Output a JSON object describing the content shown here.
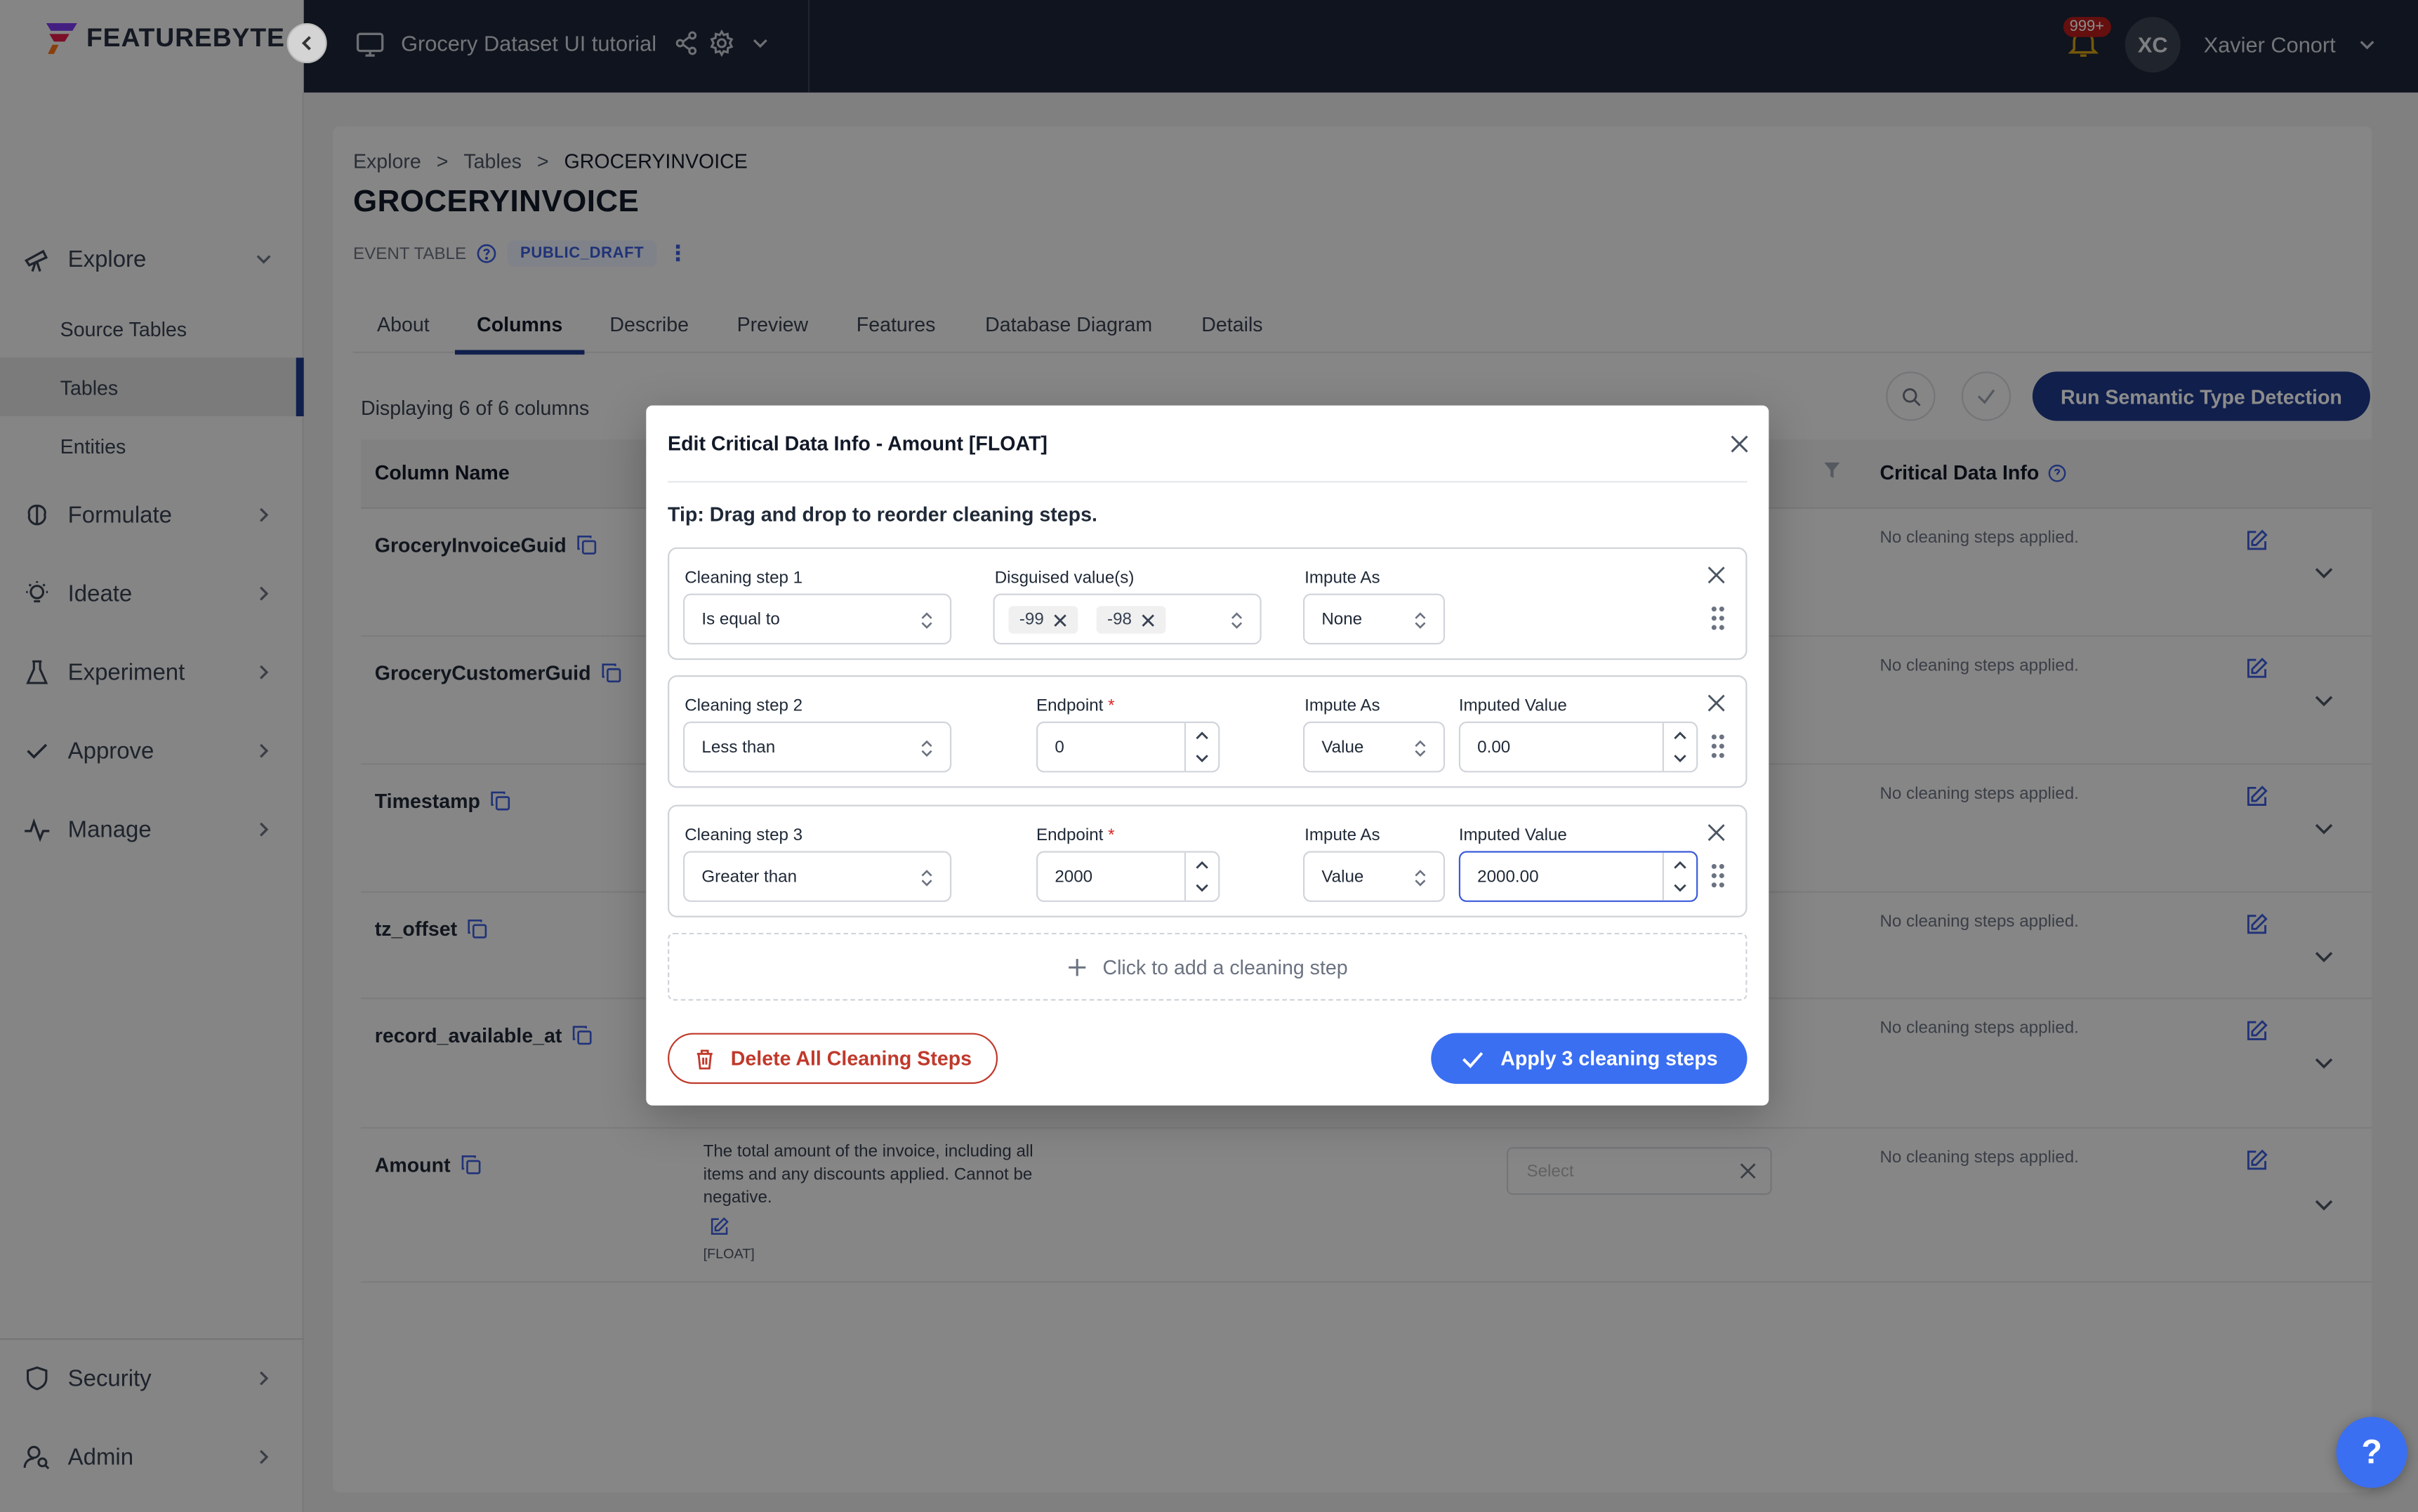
{
  "brand": {
    "name": "FEATUREBYTE"
  },
  "topbar": {
    "workspace": "Grocery Dataset UI tutorial",
    "notifications": "999+",
    "user_initials": "XC",
    "user_name": "Xavier Conort"
  },
  "sidebar": {
    "explore": "Explore",
    "explore_sub": [
      "Source Tables",
      "Tables",
      "Entities"
    ],
    "formulate": "Formulate",
    "ideate": "Ideate",
    "experiment": "Experiment",
    "approve": "Approve",
    "manage": "Manage",
    "security": "Security",
    "admin": "Admin"
  },
  "breadcrumb": [
    "Explore",
    ">",
    "Tables",
    ">",
    "GROCERYINVOICE"
  ],
  "page": {
    "title": "GROCERYINVOICE",
    "table_type": "EVENT TABLE",
    "status": "PUBLIC_DRAFT",
    "more": "⋮"
  },
  "tabs": [
    "About",
    "Columns",
    "Describe",
    "Preview",
    "Features",
    "Database Diagram",
    "Details"
  ],
  "table": {
    "display_count": "Displaying 6 of 6 columns",
    "run_button": "Run Semantic Type Detection",
    "headers": {
      "column_name": "Column Name",
      "critical": "Critical Data Info"
    },
    "rows": [
      {
        "name": "GroceryInvoiceGuid",
        "critical": "No cleaning steps applied."
      },
      {
        "name": "GroceryCustomerGuid",
        "critical": "No cleaning steps applied."
      },
      {
        "name": "Timestamp",
        "critical": "No cleaning steps applied."
      },
      {
        "name": "tz_offset",
        "critical": "No cleaning steps applied."
      },
      {
        "name": "record_available_at",
        "critical": "No cleaning steps applied."
      },
      {
        "name": "Amount",
        "critical": "No cleaning steps applied.",
        "description": "The total amount of the invoice, including all items and any discounts applied. Cannot be negative.",
        "type": "[FLOAT]",
        "select_placeholder": "Select"
      }
    ]
  },
  "modal": {
    "title": "Edit Critical Data Info - Amount [FLOAT]",
    "tip": "Tip: Drag and drop to reorder cleaning steps.",
    "steps": [
      {
        "label": "Cleaning step 1",
        "condition": "Is equal to",
        "values_label": "Disguised value(s)",
        "values": [
          "-99",
          "-98"
        ],
        "impute_label": "Impute As",
        "impute": "None"
      },
      {
        "label": "Cleaning step 2",
        "condition": "Less than",
        "endpoint_label": "Endpoint",
        "endpoint": "0",
        "impute_label": "Impute As",
        "impute": "Value",
        "imputed_label": "Imputed Value",
        "imputed": "0.00"
      },
      {
        "label": "Cleaning step 3",
        "condition": "Greater than",
        "endpoint_label": "Endpoint",
        "endpoint": "2000",
        "impute_label": "Impute As",
        "impute": "Value",
        "imputed_label": "Imputed Value",
        "imputed": "2000.00"
      }
    ],
    "required_mark": "*",
    "add_step": "Click to add a cleaning step",
    "delete_all": "Delete All Cleaning Steps",
    "apply": "Apply 3 cleaning steps"
  },
  "help": "?",
  "colors": {
    "primary": "#1e3a8a",
    "accent": "#3b6ff2",
    "danger": "#c0392b",
    "topbar": "#1d2638"
  }
}
